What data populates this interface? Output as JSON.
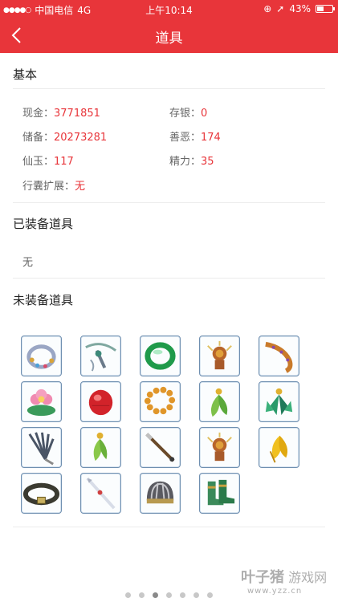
{
  "status_bar": {
    "carrier": "中国电信",
    "network": "4G",
    "time": "上午10:14",
    "battery_percent": "43%",
    "battery_level": 0.43
  },
  "nav": {
    "title": "道具"
  },
  "basic": {
    "title": "基本",
    "stats": [
      {
        "key": "现金：",
        "value": "3771851"
      },
      {
        "key": "存银：",
        "value": "0"
      },
      {
        "key": "储备：",
        "value": "20273281"
      },
      {
        "key": "善恶：",
        "value": "174"
      },
      {
        "key": "仙玉：",
        "value": "117"
      },
      {
        "key": "精力：",
        "value": "35"
      },
      {
        "key": "行囊扩展：",
        "value": "无"
      }
    ]
  },
  "equipped": {
    "title": "已装备道具",
    "empty_text": "无"
  },
  "unequipped": {
    "title": "未装备道具",
    "items": [
      {
        "icon": "jeweled-ring-icon"
      },
      {
        "icon": "sword-necklace-icon"
      },
      {
        "icon": "jade-bracelet-icon"
      },
      {
        "icon": "golden-charm-icon"
      },
      {
        "icon": "sash-ribbon-icon"
      },
      {
        "icon": "lotus-flower-icon"
      },
      {
        "icon": "red-gem-icon"
      },
      {
        "icon": "golden-beads-icon"
      },
      {
        "icon": "leaf-pendant-icon"
      },
      {
        "icon": "green-gem-cluster-icon"
      },
      {
        "icon": "feather-fan-icon"
      },
      {
        "icon": "leaf-earring-icon"
      },
      {
        "icon": "staff-weapon-icon"
      },
      {
        "icon": "golden-charm-icon"
      },
      {
        "icon": "gold-leaf-icon"
      },
      {
        "icon": "belt-icon"
      },
      {
        "icon": "white-spear-icon"
      },
      {
        "icon": "striped-helmet-icon"
      },
      {
        "icon": "green-boots-icon"
      }
    ]
  },
  "pager": {
    "count": 7,
    "active_index": 2
  },
  "watermark": {
    "cn": "叶子猪",
    "sub": "游戏网",
    "url": "www.yzz.cn"
  },
  "colors": {
    "accent": "#e8353a",
    "value_red": "#e8353a"
  }
}
